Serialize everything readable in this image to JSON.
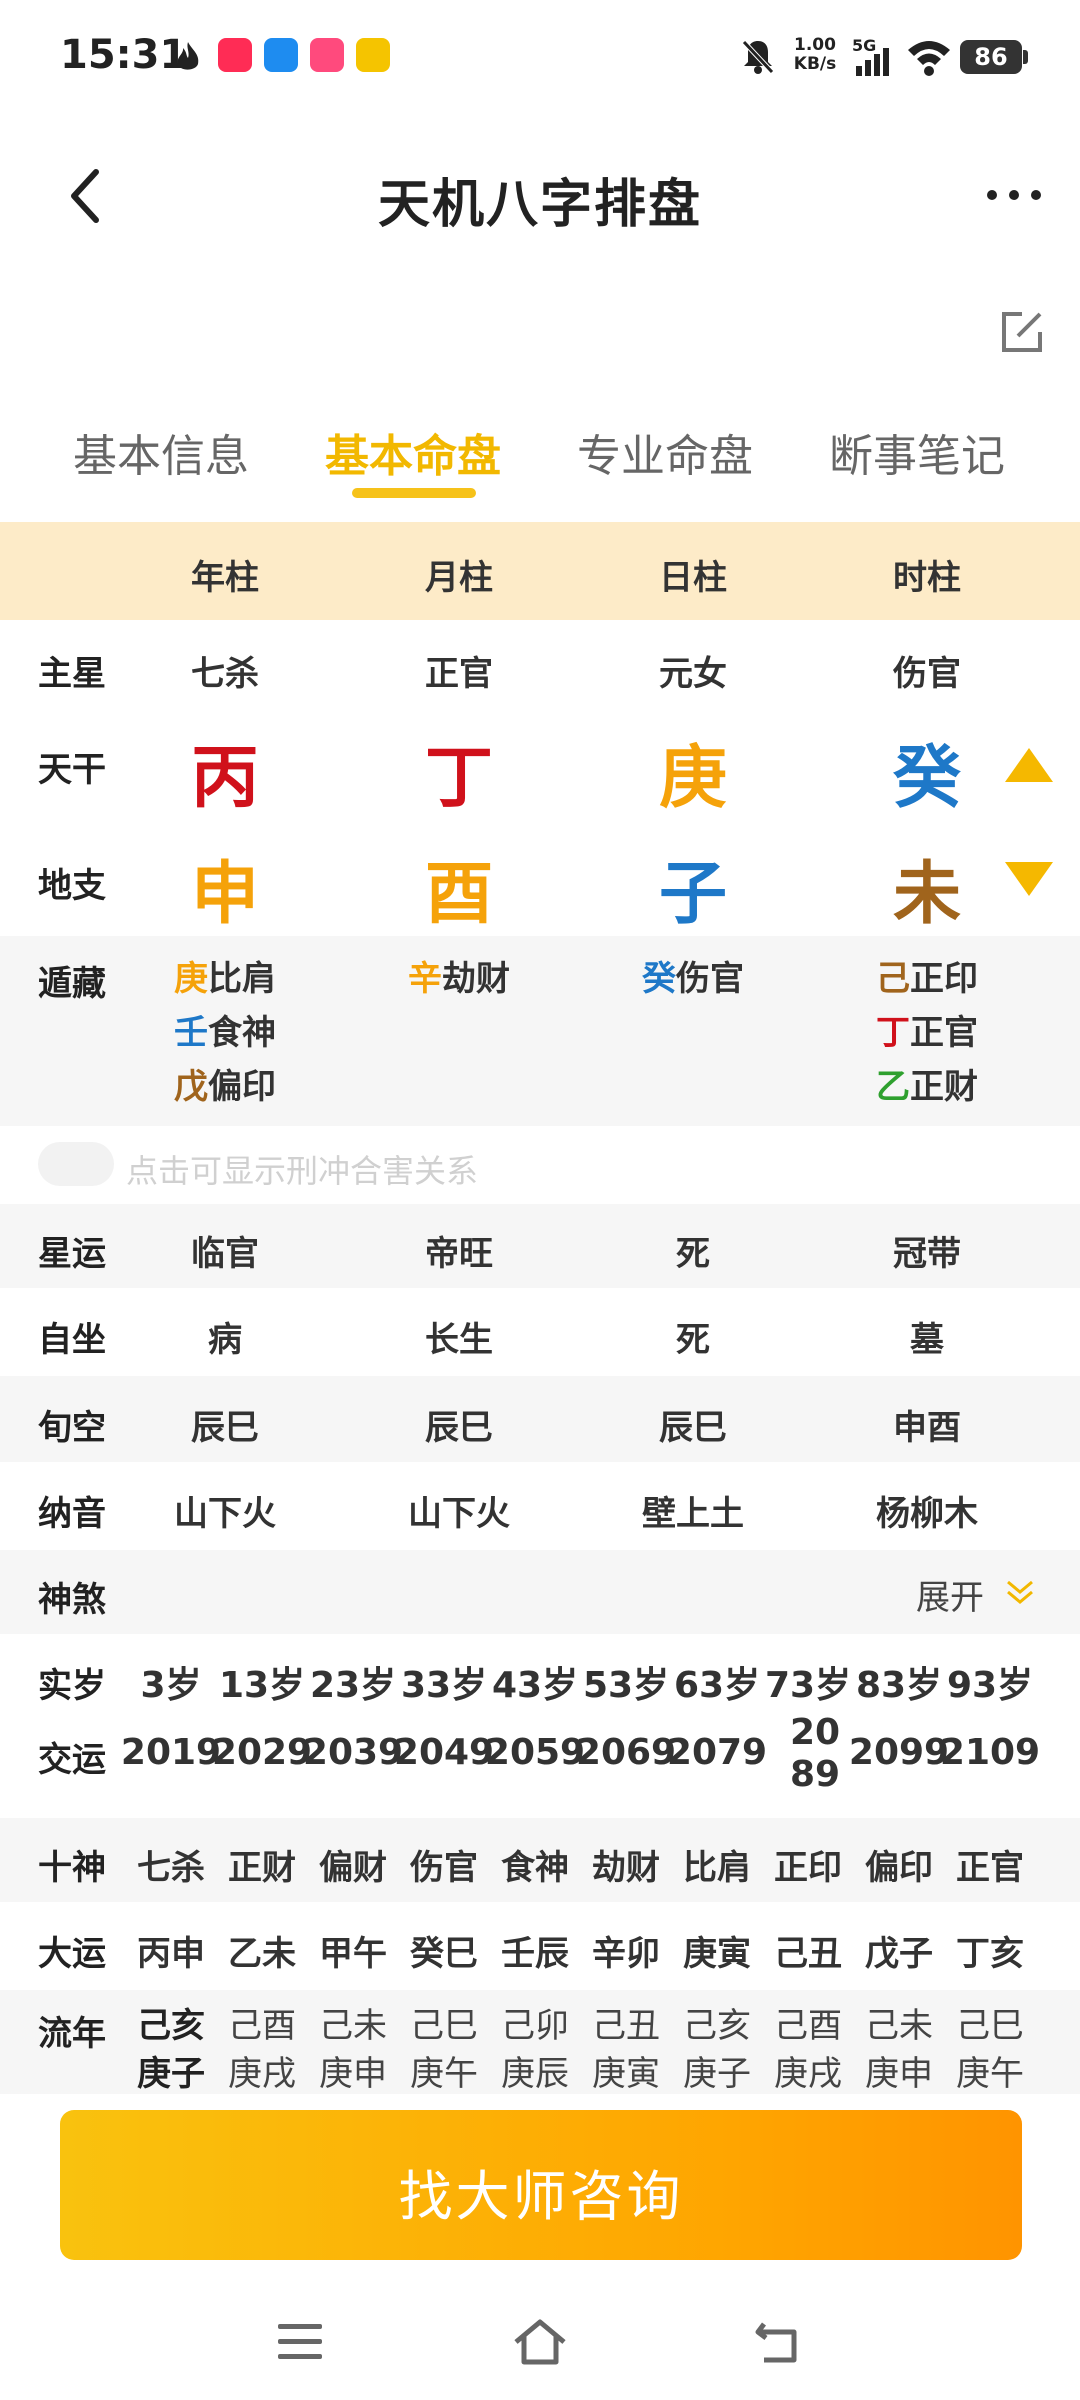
{
  "status_bar": {
    "time": "15:31",
    "speed_value": "1.00",
    "speed_unit": "KB/s",
    "network": "5G",
    "battery": "86",
    "icons": [
      "flame-icon",
      "video-app-icon",
      "browser-app-icon",
      "lofter-app-icon",
      "pay-app-icon",
      "mute-icon",
      "signal-icon",
      "wifi-icon"
    ]
  },
  "header": {
    "title": "天机八字排盘",
    "back_icon": "chevron-left-icon",
    "more_icon": "more-dots-icon"
  },
  "tabs": [
    {
      "label": "基本信息"
    },
    {
      "label": "基本命盘"
    },
    {
      "label": "专业命盘"
    },
    {
      "label": "断事笔记"
    }
  ],
  "active_tab": 1,
  "accent_color": "#F2B800",
  "pillars": {
    "headers": [
      "年柱",
      "月柱",
      "日柱",
      "时柱"
    ]
  },
  "rows": {
    "zhuxing": {
      "label": "主星",
      "values": [
        "七杀",
        "正官",
        "元女",
        "伤官"
      ]
    },
    "tiangan": {
      "label": "天干",
      "chars": [
        "丙",
        "丁",
        "庚",
        "癸"
      ],
      "colors": [
        "#D0111B",
        "#D0111B",
        "#F5A20A",
        "#1E78C8"
      ]
    },
    "dizhi": {
      "label": "地支",
      "chars": [
        "申",
        "酉",
        "子",
        "未"
      ],
      "colors": [
        "#F5A20A",
        "#F5A20A",
        "#1E78C8",
        "#A0641C"
      ]
    },
    "canggan": {
      "label": "遁藏",
      "cols": [
        [
          {
            "stem": "庚",
            "color": "#F5A20A",
            "god": "比肩"
          },
          {
            "stem": "壬",
            "color": "#1E78C8",
            "god": "食神"
          },
          {
            "stem": "戊",
            "color": "#A0641C",
            "god": "偏印"
          }
        ],
        [
          {
            "stem": "辛",
            "color": "#F5A20A",
            "god": "劫财"
          }
        ],
        [
          {
            "stem": "癸",
            "color": "#1E78C8",
            "god": "伤官"
          }
        ],
        [
          {
            "stem": "己",
            "color": "#A0641C",
            "god": "正印"
          },
          {
            "stem": "丁",
            "color": "#D0111B",
            "god": "正官"
          },
          {
            "stem": "乙",
            "color": "#2EA02E",
            "god": "正财"
          }
        ]
      ]
    },
    "toggle_hint": "点击可显示刑冲合害关系",
    "xingyun": {
      "label": "星运",
      "values": [
        "临官",
        "帝旺",
        "死",
        "冠带"
      ]
    },
    "zizuo": {
      "label": "自坐",
      "values": [
        "病",
        "长生",
        "死",
        "墓"
      ]
    },
    "xunkong": {
      "label": "旬空",
      "values": [
        "辰巳",
        "辰巳",
        "辰巳",
        "申酉"
      ]
    },
    "nayin": {
      "label": "纳音",
      "values": [
        "山下火",
        "山下火",
        "壁上土",
        "杨柳木"
      ]
    },
    "shensha": {
      "label": "神煞",
      "expand": "展开"
    }
  },
  "dayun": {
    "shisui": {
      "label": "实岁",
      "values": [
        "3岁",
        "13岁",
        "23岁",
        "33岁",
        "43岁",
        "53岁",
        "63岁",
        "73岁",
        "83岁",
        "93岁"
      ]
    },
    "jiaoyun": {
      "label": "交运",
      "values": [
        "2019",
        "2029",
        "2039",
        "2049",
        "2059",
        "2069",
        "2079",
        "2089",
        "2099",
        "2109"
      ]
    },
    "shishen": {
      "label": "十神",
      "values": [
        "七杀",
        "正财",
        "偏财",
        "伤官",
        "食神",
        "劫财",
        "比肩",
        "正印",
        "偏印",
        "正官"
      ]
    },
    "dayun": {
      "label": "大运",
      "values": [
        "丙申",
        "乙未",
        "甲午",
        "癸巳",
        "壬辰",
        "辛卯",
        "庚寅",
        "己丑",
        "戊子",
        "丁亥"
      ]
    },
    "liunian": {
      "label": "流年",
      "line1": [
        "己亥",
        "己酉",
        "己未",
        "己巳",
        "己卯",
        "己丑",
        "己亥",
        "己酉",
        "己未",
        "己巳"
      ],
      "line2": [
        "庚子",
        "庚戌",
        "庚申",
        "庚午",
        "庚辰",
        "庚寅",
        "庚子",
        "庚戌",
        "庚申",
        "庚午"
      ]
    }
  },
  "consult_button": {
    "label": "找大师咨询"
  },
  "nav_bar": {
    "icons": [
      "menu-icon",
      "home-icon",
      "back-icon"
    ]
  }
}
